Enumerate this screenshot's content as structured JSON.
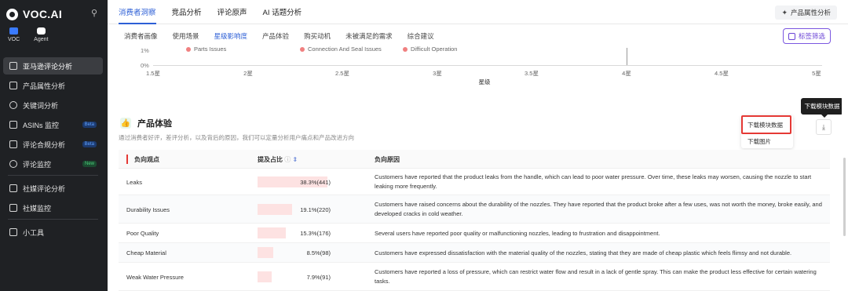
{
  "app": {
    "name": "VOC.AI"
  },
  "sidebar": {
    "sub": [
      {
        "label": "VOC"
      },
      {
        "label": "Agent"
      }
    ],
    "items": [
      {
        "label": "亚马逊评论分析",
        "badge": ""
      },
      {
        "label": "产品属性分析",
        "badge": ""
      },
      {
        "label": "关键词分析",
        "badge": ""
      },
      {
        "label": "ASINs 监控",
        "badge": "Beta"
      },
      {
        "label": "评论合规分析",
        "badge": "Beta"
      },
      {
        "label": "评论监控",
        "badge": "New"
      },
      {
        "label": "社媒评论分析",
        "badge": ""
      },
      {
        "label": "社媒监控",
        "badge": ""
      },
      {
        "label": "小工具",
        "badge": ""
      }
    ]
  },
  "header": {
    "tabs": [
      "消费者洞察",
      "竞品分析",
      "评论原声",
      "AI 话题分析"
    ],
    "attr_button": "产品属性分析",
    "subtabs": [
      "消费者画像",
      "使用场景",
      "星级影响度",
      "产品体验",
      "购买动机",
      "未被满足的需求",
      "综合建议"
    ],
    "tag_filter": "标签筛选"
  },
  "chart_data": {
    "type": "scatter",
    "y_ticks": [
      "1%",
      "0%"
    ],
    "x_ticks": [
      "1.5星",
      "2星",
      "2.5星",
      "3星",
      "3.5星",
      "4星",
      "4.5星",
      "5星"
    ],
    "xlabel": "星级",
    "legend": [
      "Parts Issues",
      "Connection And Seal Issues",
      "Difficult Operation"
    ]
  },
  "section": {
    "title": "产品体验",
    "desc": "通过消费者好评，差评分析，以及背后的原因，我们可以定量分析用户痛点和产品改进方向",
    "tooltip": "下载模块数据",
    "menu": [
      "下载模块数据",
      "下载图片"
    ]
  },
  "table": {
    "headers": [
      "负向观点",
      "提及占比",
      "负向原因"
    ],
    "rows": [
      {
        "name": "Leaks",
        "pct": "38.3%(441)",
        "ratio": 0.383,
        "reason": "Customers have reported that the product leaks from the handle, which can lead to poor water pressure. Over time, these leaks may worsen, causing the nozzle to start leaking more frequently."
      },
      {
        "name": "Durability Issues",
        "pct": "19.1%(220)",
        "ratio": 0.191,
        "reason": "Customers have raised concerns about the durability of the nozzles. They have reported that the product broke after a few uses, was not worth the money, broke easily, and developed cracks in cold weather."
      },
      {
        "name": "Poor Quality",
        "pct": "15.3%(176)",
        "ratio": 0.153,
        "reason": "Several users have reported poor quality or malfunctioning nozzles, leading to frustration and disappointment."
      },
      {
        "name": "Cheap Material",
        "pct": "8.5%(98)",
        "ratio": 0.085,
        "reason": "Customers have expressed dissatisfaction with the material quality of the nozzles, stating that they are made of cheap plastic which feels flimsy and not durable."
      },
      {
        "name": "Weak Water Pressure",
        "pct": "7.9%(91)",
        "ratio": 0.079,
        "reason": "Customers have reported a loss of pressure, which can restrict water flow and result in a lack of gentle spray. This can make the product less effective for certain watering tasks."
      }
    ]
  },
  "colors": {
    "accent": "#2d5fd6",
    "highlight": "#e53935",
    "bar": "#fde2e2"
  }
}
